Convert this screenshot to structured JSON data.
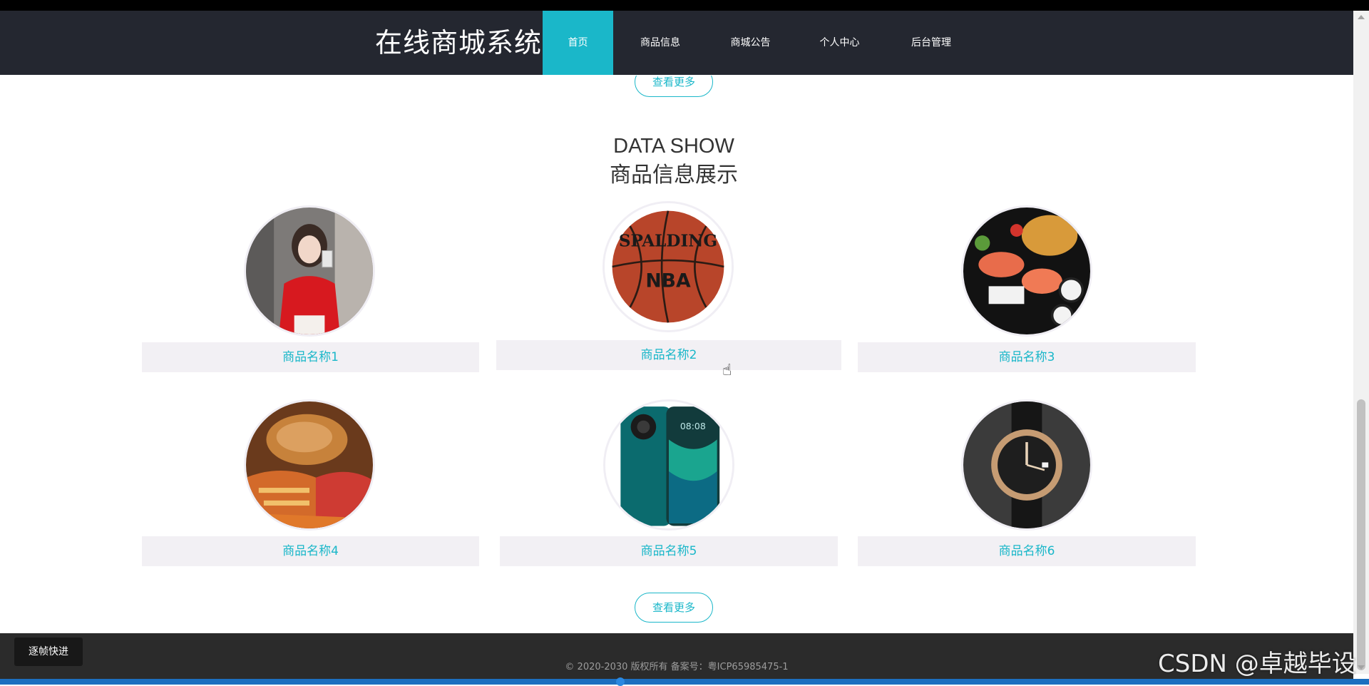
{
  "site": {
    "brand": "在线商城系统"
  },
  "nav": {
    "items": [
      {
        "label": "首页",
        "active": true
      },
      {
        "label": "商品信息",
        "active": false
      },
      {
        "label": "商城公告",
        "active": false
      },
      {
        "label": "个人中心",
        "active": false
      },
      {
        "label": "后台管理",
        "active": false
      }
    ]
  },
  "section": {
    "top_more_label": "查看更多",
    "title_en": "DATA SHOW",
    "title_cn": "商品信息展示",
    "bottom_more_label": "查看更多",
    "products": [
      {
        "name": "商品名称1",
        "image": "woman-red-top"
      },
      {
        "name": "商品名称2",
        "image": "basketball"
      },
      {
        "name": "商品名称3",
        "image": "sushi-platter"
      },
      {
        "name": "商品名称4",
        "image": "fried-chicken"
      },
      {
        "name": "商品名称5",
        "image": "smartphone"
      },
      {
        "name": "商品名称6",
        "image": "wristwatch"
      }
    ]
  },
  "footer": {
    "copyright": "© 2020-2030 版权所有 备案号：粤ICP65985475-1",
    "frame_button": "逐帧快进"
  },
  "watermark": "CSDN @卓越毕设",
  "colors": {
    "accent": "#1ab7c9",
    "nav_bg": "#242730",
    "footer_bg": "#2b2b2b"
  }
}
